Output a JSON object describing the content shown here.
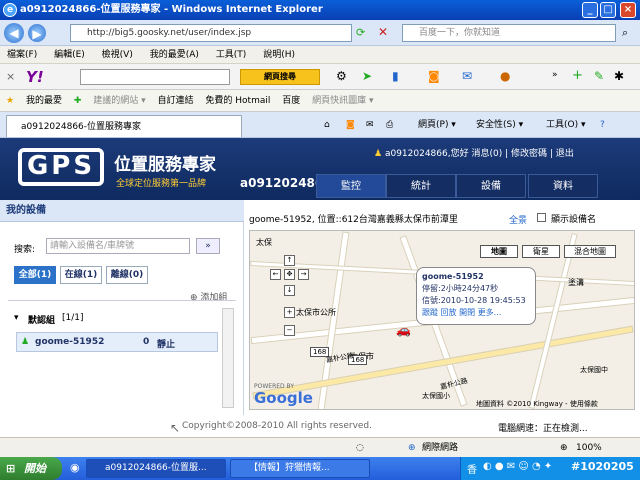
{
  "window": {
    "title": "a0912024866-位置服務專家 - Windows Internet Explorer"
  },
  "address": {
    "url": "http://big5.goosky.net/user/index.jsp",
    "search_placeholder": "百度一下，你就知道"
  },
  "menu": [
    "檔案(F)",
    "編輯(E)",
    "檢視(V)",
    "我的最愛(A)",
    "工具(T)",
    "說明(H)"
  ],
  "yahoo": {
    "logo": "Y!",
    "search_btn": "網頁搜尋"
  },
  "favorites": {
    "label": "我的最愛",
    "items": [
      "建議的網站 ▾",
      "自訂連結",
      "免費的 Hotmail",
      "百度",
      "網頁快訊圖庫 ▾"
    ]
  },
  "tab": {
    "label": "a0912024866-位置服務專家"
  },
  "commands": {
    "page": "網頁(P) ▾",
    "safety": "安全性(S) ▾",
    "tools": "工具(O) ▾"
  },
  "gps": {
    "logo": "GPS",
    "title": "位置服務專家",
    "subtitle": "全球定位服務第一品牌",
    "user": "a0912024866",
    "toplinks": "a0912024866,您好 消息(0) | 修改密碼 | 退出",
    "tabs": [
      "監控",
      "統計",
      "設備",
      "資料"
    ]
  },
  "sidebar": {
    "header": "我的設備",
    "search_label": "搜索:",
    "search_placeholder": "請輸入設備名/車牌號",
    "filters": [
      "全部(1)",
      "在線(1)",
      "離線(0)"
    ],
    "add_group": "添加組",
    "group_name": "默認組",
    "group_count": "[1/1]",
    "device": {
      "name": "goome-51952",
      "count": "0",
      "status": "靜止"
    }
  },
  "map": {
    "location_text": "goome-51952, 位置::612台灣嘉義縣太保市前潭里",
    "fullscreen": "全景",
    "show_name": "顯示設備名",
    "types": [
      "地圖",
      "衛星",
      "混合地圖"
    ],
    "info": {
      "name": "goome-51952",
      "stop": "停留:2小時24分47秒",
      "signal": "信號:2010-10-28 19:45:53",
      "links": [
        "跟蹤",
        "回放",
        "開閉",
        "更多..."
      ]
    },
    "labels": [
      "太保",
      "太保市",
      "太保市公所",
      "168",
      "168",
      "嘉朴公路",
      "嘉朴公路",
      "太保國小",
      "塗溝",
      "太保國中"
    ],
    "powered": "POWERED BY",
    "google": "Google",
    "copyright": "地圖資料 ©2010 Kingway - 使用條款"
  },
  "footer": {
    "copyright": "Copyright©2008-2010 All rights reserved.",
    "status": "電腦網速：正在檢測..."
  },
  "statusbar": {
    "zone": "網際網路",
    "zoom": "100%"
  },
  "taskbar": {
    "start": "開始",
    "items": [
      "a0912024866-位置服...",
      "【情報】狩獵情報..."
    ],
    "ime": "香",
    "watermark": "#1020205"
  }
}
